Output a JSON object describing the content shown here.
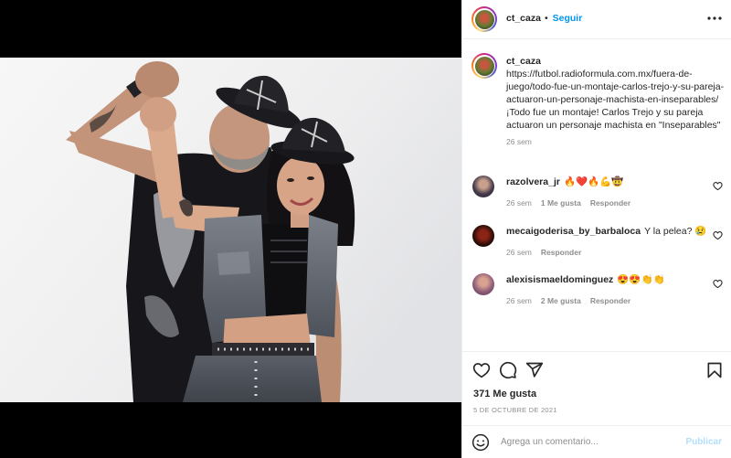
{
  "post": {
    "author": "ct_caza",
    "separator": "•",
    "follow_label": "Seguir"
  },
  "caption": {
    "username": "ct_caza",
    "text": "https://futbol.radioformula.com.mx/fuera-de-juego/todo-fue-un-montaje-carlos-trejo-y-su-pareja-actuaron-un-personaje-machista-en-inseparables/ ¡Todo fue un montaje! Carlos Trejo y su pareja actuaron un personaje machista en \"Inseparables\"",
    "time": "26 sem"
  },
  "comments": [
    {
      "username": "razolvera_jr",
      "text": "🔥❤️🔥💪🤠",
      "time": "26 sem",
      "likes": "1 Me gusta",
      "reply": "Responder"
    },
    {
      "username": "mecaigoderisa_by_barbaloca",
      "text": "Y la pelea? 😢",
      "time": "26 sem",
      "reply": "Responder"
    },
    {
      "username": "alexisismaeldominguez",
      "text": "😍😍👏👏",
      "time": "26 sem",
      "likes": "2 Me gusta",
      "reply": "Responder"
    }
  ],
  "engagement": {
    "likes": "371 Me gusta",
    "date": "5 DE OCTUBRE DE 2021"
  },
  "composer": {
    "placeholder": "Agrega un comentario...",
    "post_label": "Publicar"
  },
  "icons": {
    "more": "more-horizontal-icon",
    "like": "heart-icon",
    "comment": "comment-icon",
    "share": "share-icon",
    "save": "bookmark-icon",
    "emoji": "smiley-icon"
  },
  "colors": {
    "accent": "#0095f6",
    "publish_disabled": "#b2dffc",
    "text_primary": "#262626",
    "text_secondary": "#8e8e8e",
    "divider": "#efefef",
    "media_background": "#000000"
  }
}
